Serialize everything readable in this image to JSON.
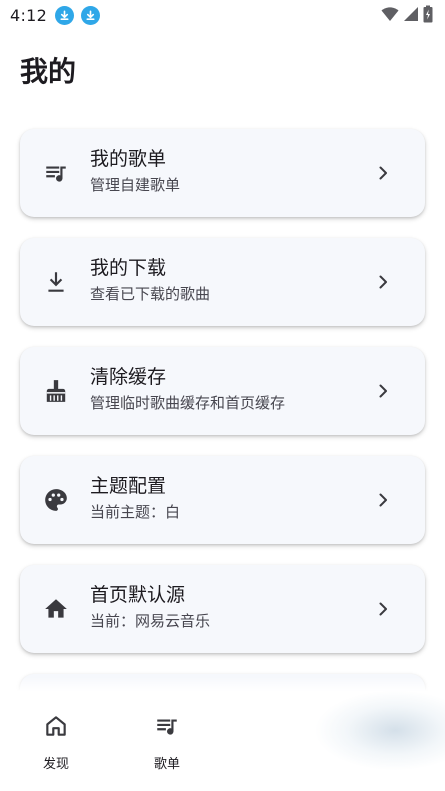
{
  "status_bar": {
    "time": "4:12",
    "icons": [
      "download-notification-icon",
      "download-notification-icon",
      "wifi-icon",
      "signal-icon",
      "battery-charging-icon"
    ]
  },
  "page": {
    "title": "我的"
  },
  "colors": {
    "card_background": "#f6f8fc",
    "icon_color": "#3a3a3f",
    "notification_blue": "#2fa7e8"
  },
  "cards": [
    {
      "icon": "playlist-icon",
      "title": "我的歌单",
      "subtitle": "管理自建歌单"
    },
    {
      "icon": "download-icon",
      "title": "我的下载",
      "subtitle": "查看已下载的歌曲"
    },
    {
      "icon": "broom-icon",
      "title": "清除缓存",
      "subtitle": "管理临时歌曲缓存和首页缓存"
    },
    {
      "icon": "palette-icon",
      "title": "主题配置",
      "subtitle": "当前主题：白"
    },
    {
      "icon": "home-icon",
      "title": "首页默认源",
      "subtitle": "当前：网易云音乐"
    }
  ],
  "bottom_nav": {
    "items": [
      {
        "icon": "home-outline-icon",
        "label": "发现"
      },
      {
        "icon": "playlist-icon",
        "label": "歌单"
      }
    ]
  }
}
